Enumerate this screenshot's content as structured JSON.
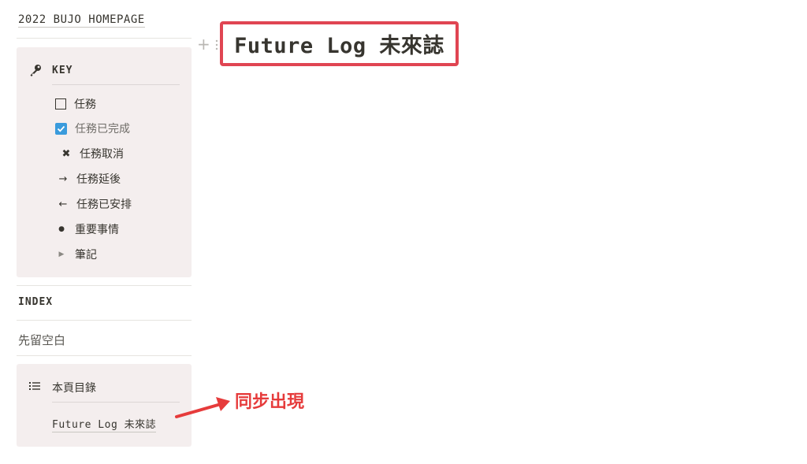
{
  "sidebar": {
    "top_link": "2022 BUJO HOMEPAGE",
    "key": {
      "title": "KEY",
      "items": [
        {
          "icon": "checkbox-empty-icon",
          "label": "任務"
        },
        {
          "icon": "checkbox-checked-icon",
          "label": "任務已完成"
        },
        {
          "icon": "x-mark-icon",
          "symbol": "✖",
          "label": "任務取消"
        },
        {
          "icon": "arrow-right-icon",
          "symbol": "→",
          "label": "任務延後"
        },
        {
          "icon": "arrow-left-icon",
          "symbol": "←",
          "label": "任務已安排"
        },
        {
          "icon": "bullet-dot-icon",
          "symbol": "●",
          "label": "重要事情"
        },
        {
          "icon": "triangle-right-icon",
          "symbol": "▶",
          "label": "筆記"
        }
      ]
    },
    "index": {
      "title": "INDEX",
      "text": "先留空白"
    },
    "toc": {
      "title": "本頁目錄",
      "link": "Future Log 未來誌"
    }
  },
  "main": {
    "page_title": "Future Log 未來誌",
    "controls": {
      "add": "+"
    }
  },
  "annotation": {
    "text": "同步出現",
    "color": "#e63b3b"
  },
  "colors": {
    "accent_red": "#e04552",
    "card_bg": "#f4eeee",
    "checkbox_blue": "#3a9bdc"
  }
}
